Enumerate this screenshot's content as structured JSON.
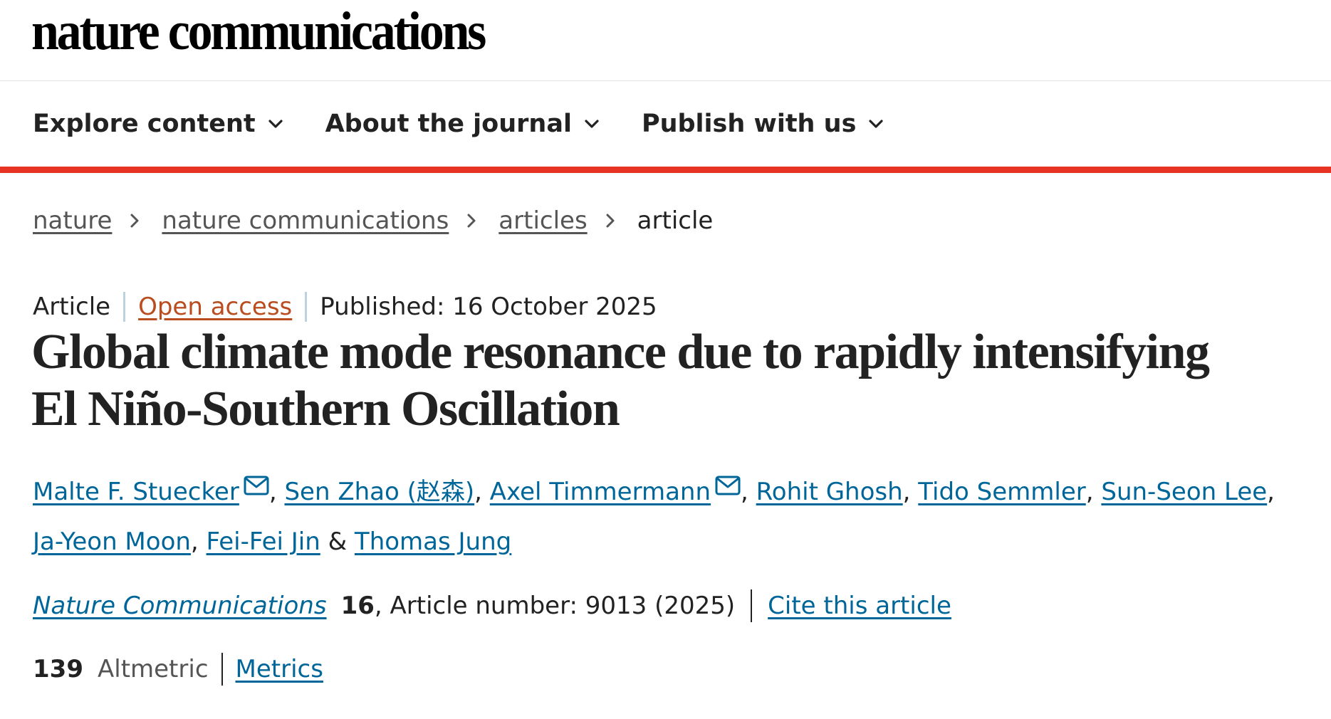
{
  "masthead": {
    "logo_text": "nature communications"
  },
  "nav": {
    "items": [
      {
        "label": "Explore content",
        "icon": "chevron-down-icon"
      },
      {
        "label": "About the journal",
        "icon": "chevron-down-icon"
      },
      {
        "label": "Publish with us",
        "icon": "chevron-down-icon"
      }
    ]
  },
  "breadcrumb": {
    "items": [
      "nature",
      "nature communications",
      "articles"
    ],
    "current": "article",
    "separator_icon": "chevron-right-icon"
  },
  "article": {
    "type": "Article",
    "access": "Open access",
    "published": "Published: 16 October 2025",
    "title": "Global climate mode resonance due to rapidly intensifying El Niño-Southern Oscillation",
    "authors": [
      {
        "name": "Malte F. Stuecker",
        "email_icon": true
      },
      {
        "name": "Sen Zhao  (赵森)",
        "email_icon": false
      },
      {
        "name": "Axel Timmermann",
        "email_icon": true
      },
      {
        "name": "Rohit Ghosh",
        "email_icon": false
      },
      {
        "name": "Tido Semmler",
        "email_icon": false
      },
      {
        "name": "Sun-Seon Lee",
        "email_icon": false
      },
      {
        "name": "Ja-Yeon Moon",
        "email_icon": false
      },
      {
        "name": "Fei-Fei Jin",
        "email_icon": false
      },
      {
        "name": "Thomas Jung",
        "email_icon": false
      }
    ],
    "citation": {
      "journal": "Nature Communications",
      "volume": "16",
      "article_number": ", Article number: 9013 (2025)",
      "cite_link": "Cite this article"
    },
    "metrics": {
      "altmetric_count": "139",
      "altmetric_label": "Altmetric",
      "metrics_link": "Metrics"
    }
  },
  "colors": {
    "accent_red": "#e63323",
    "link_blue": "#006699",
    "open_access_orange": "#b94d1f"
  }
}
